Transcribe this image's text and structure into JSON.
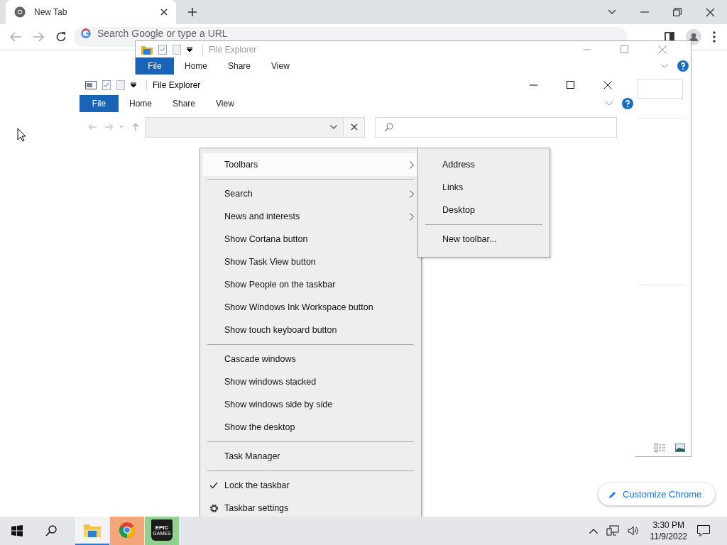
{
  "browser": {
    "tabs": [
      {
        "label": "New Tab",
        "selected": true
      }
    ],
    "omnibox": {
      "placeholder": "Search Google or type a URL"
    },
    "customize_button": "Customize Chrome"
  },
  "windows": [
    {
      "title": "File Explorer",
      "active": false,
      "file_button": "File",
      "ribbon_tabs": [
        "Home",
        "Share",
        "View"
      ]
    },
    {
      "title": "File Explorer",
      "active": true,
      "file_button": "File",
      "ribbon_tabs": [
        "Home",
        "Share",
        "View"
      ]
    }
  ],
  "context_menu": {
    "items": [
      {
        "kind": "submenu",
        "label": "Toolbars",
        "selected": true
      },
      {
        "kind": "separator"
      },
      {
        "kind": "submenu",
        "label": "Search",
        "selected": false
      },
      {
        "kind": "submenu",
        "label": "News and interests",
        "selected": false
      },
      {
        "kind": "item",
        "label": "Show Cortana button",
        "selected": false
      },
      {
        "kind": "item",
        "label": "Show Task View button",
        "selected": false
      },
      {
        "kind": "item",
        "label": "Show People on the taskbar",
        "selected": false
      },
      {
        "kind": "item",
        "label": "Show Windows Ink Workspace button",
        "selected": false
      },
      {
        "kind": "item",
        "label": "Show touch keyboard button",
        "selected": false
      },
      {
        "kind": "separator"
      },
      {
        "kind": "item",
        "label": "Cascade windows",
        "selected": false
      },
      {
        "kind": "item",
        "label": "Show windows stacked",
        "selected": false
      },
      {
        "kind": "item",
        "label": "Show windows side by side",
        "selected": false
      },
      {
        "kind": "item",
        "label": "Show the desktop",
        "selected": false
      },
      {
        "kind": "separator"
      },
      {
        "kind": "item",
        "label": "Task Manager",
        "selected": false
      },
      {
        "kind": "separator"
      },
      {
        "kind": "check",
        "label": "Lock the taskbar",
        "checked": true,
        "selected": false
      },
      {
        "kind": "settings",
        "label": "Taskbar settings",
        "selected": false
      }
    ]
  },
  "submenu": {
    "items": [
      {
        "kind": "item",
        "label": "Address",
        "selected": false
      },
      {
        "kind": "item",
        "label": "Links",
        "selected": false
      },
      {
        "kind": "item",
        "label": "Desktop",
        "selected": false
      },
      {
        "kind": "separator"
      },
      {
        "kind": "item",
        "label": "New toolbar...",
        "selected": false
      }
    ]
  },
  "taskbar": {
    "apps": [
      {
        "kind": "explorer",
        "active": true
      },
      {
        "kind": "chrome",
        "active": false
      },
      {
        "kind": "epic",
        "active": false,
        "logo_text": "EPIC",
        "logo_subtext": "GAMES"
      }
    ],
    "time": "3:30 PM",
    "date": "11/9/2022"
  }
}
